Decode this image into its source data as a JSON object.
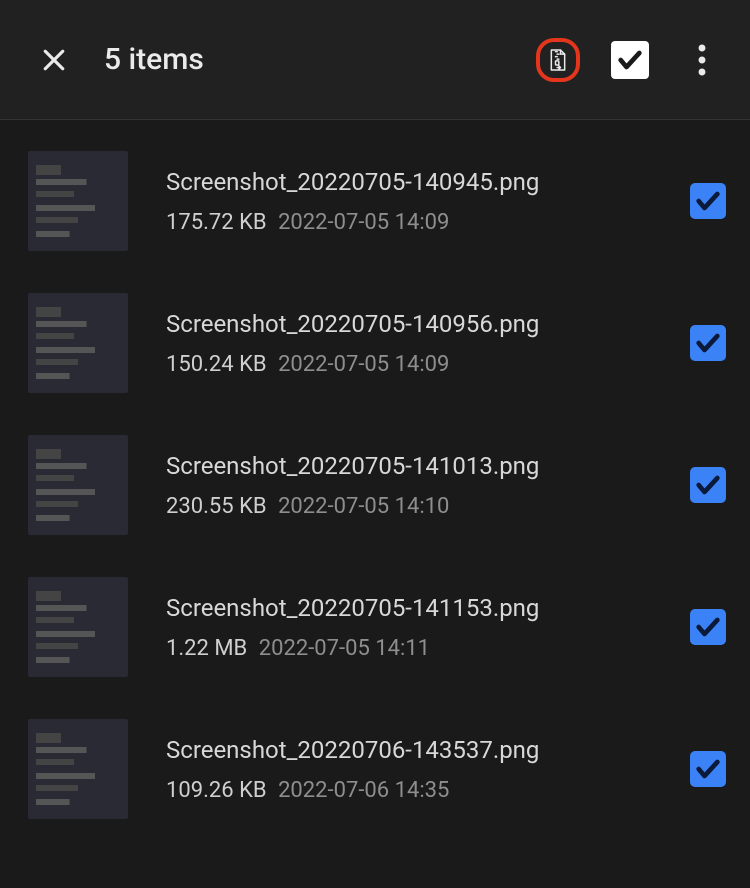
{
  "header": {
    "title": "5 items"
  },
  "files": [
    {
      "name": "Screenshot_20220705-140945.png",
      "size": "175.72 KB",
      "date": "2022-07-05 14:09",
      "selected": true
    },
    {
      "name": "Screenshot_20220705-140956.png",
      "size": "150.24 KB",
      "date": "2022-07-05 14:09",
      "selected": true
    },
    {
      "name": "Screenshot_20220705-141013.png",
      "size": "230.55 KB",
      "date": "2022-07-05 14:10",
      "selected": true
    },
    {
      "name": "Screenshot_20220705-141153.png",
      "size": "1.22 MB",
      "date": "2022-07-05 14:11",
      "selected": true
    },
    {
      "name": "Screenshot_20220706-143537.png",
      "size": "109.26 KB",
      "date": "2022-07-06 14:35",
      "selected": true
    }
  ]
}
